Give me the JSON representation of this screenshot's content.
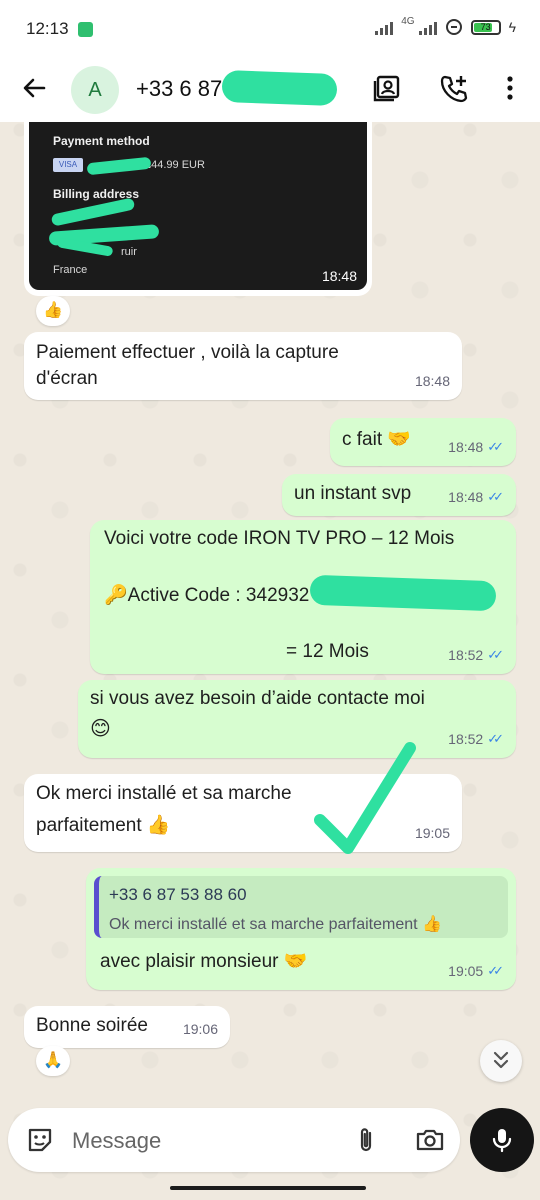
{
  "status_bar": {
    "time": "12:13",
    "network": "4G",
    "battery": "73"
  },
  "header": {
    "avatar_letter": "A",
    "contact_name": "+33 6 87"
  },
  "screenshot_card": {
    "payment_method_label": "Payment method",
    "card_brand": "VISA",
    "card_amount": "£44.99 EUR",
    "billing_address_label": "Billing address",
    "address_fragment": "ruir",
    "country": "France",
    "time": "18:48"
  },
  "reactions": {
    "r1": "👍",
    "r2": "🙏"
  },
  "messages": [
    {
      "direction": "in",
      "text_line1": "Paiement effectuer , voilà la capture",
      "text_line2": "d'écran",
      "time": "18:48"
    },
    {
      "direction": "out",
      "text": "c fait 🤝",
      "time": "18:48",
      "ticks": "✓✓"
    },
    {
      "direction": "out",
      "text": "un instant svp",
      "time": "18:48",
      "ticks": "✓✓"
    },
    {
      "direction": "out",
      "line1": "Voici votre code IRON TV PRO – 12 Mois",
      "line2": "🔑Active Code : 342932",
      "line3": "= 12 Mois",
      "time": "18:52",
      "ticks": "✓✓"
    },
    {
      "direction": "out",
      "line1": "si vous avez besoin d’aide contacte moi",
      "line2": "😊",
      "time": "18:52",
      "ticks": "✓✓"
    },
    {
      "direction": "in",
      "line1": "Ok merci installé et sa marche",
      "line2": "parfaitement 👍",
      "time": "19:05"
    },
    {
      "direction": "out",
      "quote_name": "+33 6 87 53 88 60",
      "quote_text": "Ok merci installé et sa marche parfaitement 👍",
      "text": "avec plaisir monsieur 🤝",
      "time": "19:05",
      "ticks": "✓✓"
    },
    {
      "direction": "in",
      "text": "Bonne soirée",
      "time": "19:06"
    }
  ],
  "composer": {
    "placeholder": "Message"
  },
  "icons": [
    "back-arrow-icon",
    "contact-card-icon",
    "add-call-icon",
    "more-vert-icon",
    "sticker-icon",
    "attach-icon",
    "camera-icon",
    "mic-icon",
    "chevron-double-down-icon"
  ],
  "colors": {
    "outgoing_bubble": "#d7fdd0",
    "incoming_bubble": "#ffffff",
    "read_ticks": "#3a84e6",
    "redaction_marker": "#2fe0a0"
  }
}
